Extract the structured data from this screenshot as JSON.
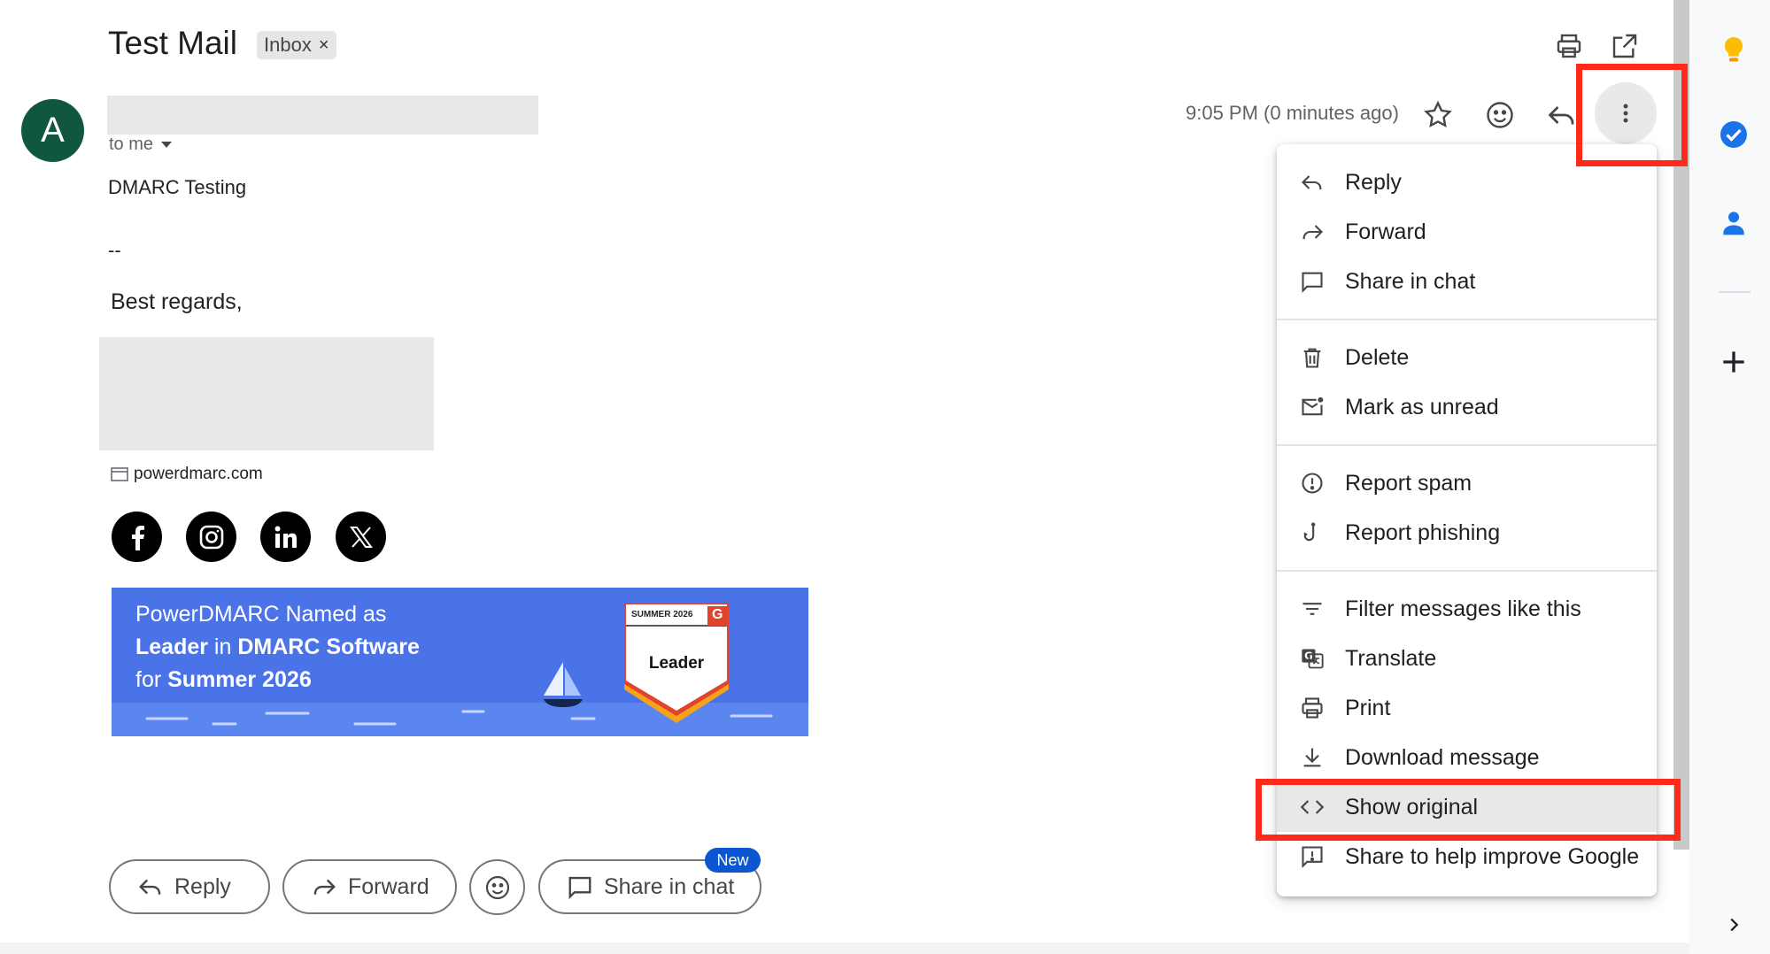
{
  "header": {
    "subject": "Test Mail",
    "label": "Inbox",
    "label_close": "×"
  },
  "sender": {
    "avatar_letter": "A",
    "recipient": "to me",
    "timestamp": "9:05 PM (0 minutes ago)"
  },
  "body": {
    "line1": "DMARC Testing",
    "line2": "--",
    "line3": "Best regards,",
    "website": "powerdmarc.com"
  },
  "banner": {
    "line1": "PowerDMARC Named as",
    "line2_bold1": "Leader",
    "line2_mid": " in ",
    "line2_bold2": "DMARC Software",
    "line3_pre": "for ",
    "line3_bold": "Summer 2026",
    "badge_season": "SUMMER 2026",
    "badge_title": "Leader",
    "badge_logo": "G"
  },
  "actions": {
    "reply": "Reply",
    "forward": "Forward",
    "share": "Share in chat",
    "new_badge": "New"
  },
  "menu": {
    "items": [
      {
        "label": "Reply",
        "icon": "reply-icon"
      },
      {
        "label": "Forward",
        "icon": "forward-icon"
      },
      {
        "label": "Share in chat",
        "icon": "chat-icon"
      },
      {
        "label": "Delete",
        "icon": "trash-icon"
      },
      {
        "label": "Mark as unread",
        "icon": "mark-unread-icon"
      },
      {
        "label": "Report spam",
        "icon": "spam-icon"
      },
      {
        "label": "Report phishing",
        "icon": "phishing-hook-icon"
      },
      {
        "label": "Filter messages like this",
        "icon": "filter-icon"
      },
      {
        "label": "Translate",
        "icon": "translate-icon"
      },
      {
        "label": "Print",
        "icon": "print-icon"
      },
      {
        "label": "Download message",
        "icon": "download-icon"
      },
      {
        "label": "Show original",
        "icon": "code-icon"
      },
      {
        "label": "Share to help improve Google",
        "icon": "feedback-icon"
      }
    ],
    "active_item": "Show original"
  },
  "side_panel": {
    "icons": [
      "keep-bulb-icon",
      "tasks-check-icon",
      "contacts-person-icon",
      "add-icon",
      "chevron-right-icon"
    ]
  },
  "colors": {
    "highlight": "#ff2a1a",
    "avatar": "#11563f",
    "banner": "#4b73e8",
    "new_badge": "#0b57d0"
  }
}
